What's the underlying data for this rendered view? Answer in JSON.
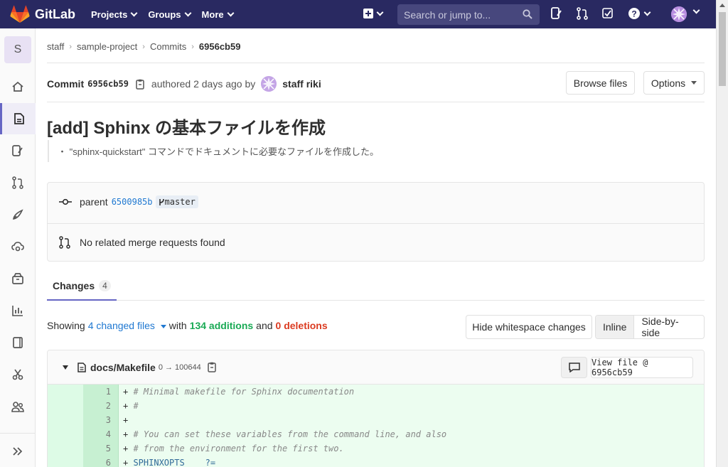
{
  "nav": {
    "brand": "GitLab",
    "menu": [
      "Projects",
      "Groups",
      "More"
    ],
    "search_placeholder": "Search or jump to..."
  },
  "sidebar": {
    "project_initial": "S",
    "items": [
      "home-icon",
      "repository-icon",
      "issues-icon",
      "merge-requests-icon",
      "ci-cd-icon",
      "operations-icon",
      "packages-icon",
      "analytics-icon",
      "wiki-icon",
      "snippets-icon",
      "members-icon"
    ],
    "collapse_icon": "double-chevron-right-icon"
  },
  "breadcrumb": [
    "staff",
    "sample-project",
    "Commits",
    "6956cb59"
  ],
  "commit": {
    "label": "Commit",
    "sha": "6956cb59",
    "authored": "authored 2 days ago by",
    "author": "staff riki",
    "browse_files": "Browse files",
    "options": "Options",
    "title": "[add] Sphinx の基本ファイルを作成",
    "description": "・ \"sphinx-quickstart\" コマンドでドキュメントに必要なファイルを作成した。",
    "parent_label": "parent",
    "parent_sha": "6500985b",
    "branch": "master",
    "merge_requests": "No related merge requests found"
  },
  "tabs": {
    "changes_label": "Changes",
    "changes_count": "4"
  },
  "diff_summary": {
    "showing": "Showing",
    "changed_files": "4 changed files",
    "with": "with",
    "additions": "134 additions",
    "and": "and",
    "deletions": "0 deletions",
    "hide_whitespace": "Hide whitespace changes",
    "inline": "Inline",
    "side_by_side": "Side-by-side"
  },
  "file": {
    "name": "docs/Makefile",
    "mode": "0 → 100644",
    "view_file": "View file @ 6956cb59",
    "lines": [
      {
        "n": "1",
        "text": "# Minimal makefile for Sphinx documentation",
        "kind": "comment"
      },
      {
        "n": "2",
        "text": "#",
        "kind": "comment"
      },
      {
        "n": "3",
        "text": "",
        "kind": "comment"
      },
      {
        "n": "4",
        "text": "# You can set these variables from the command line, and also",
        "kind": "comment"
      },
      {
        "n": "5",
        "text": "# from the environment for the first two.",
        "kind": "comment"
      },
      {
        "n": "6",
        "text": "SPHINXOPTS    ?=",
        "kind": "code"
      }
    ]
  },
  "colors": {
    "nav_bg": "#292961",
    "accent": "#6666c4",
    "link": "#1f78d1",
    "addition": "#1aaa55",
    "deletion": "#db3b21"
  }
}
